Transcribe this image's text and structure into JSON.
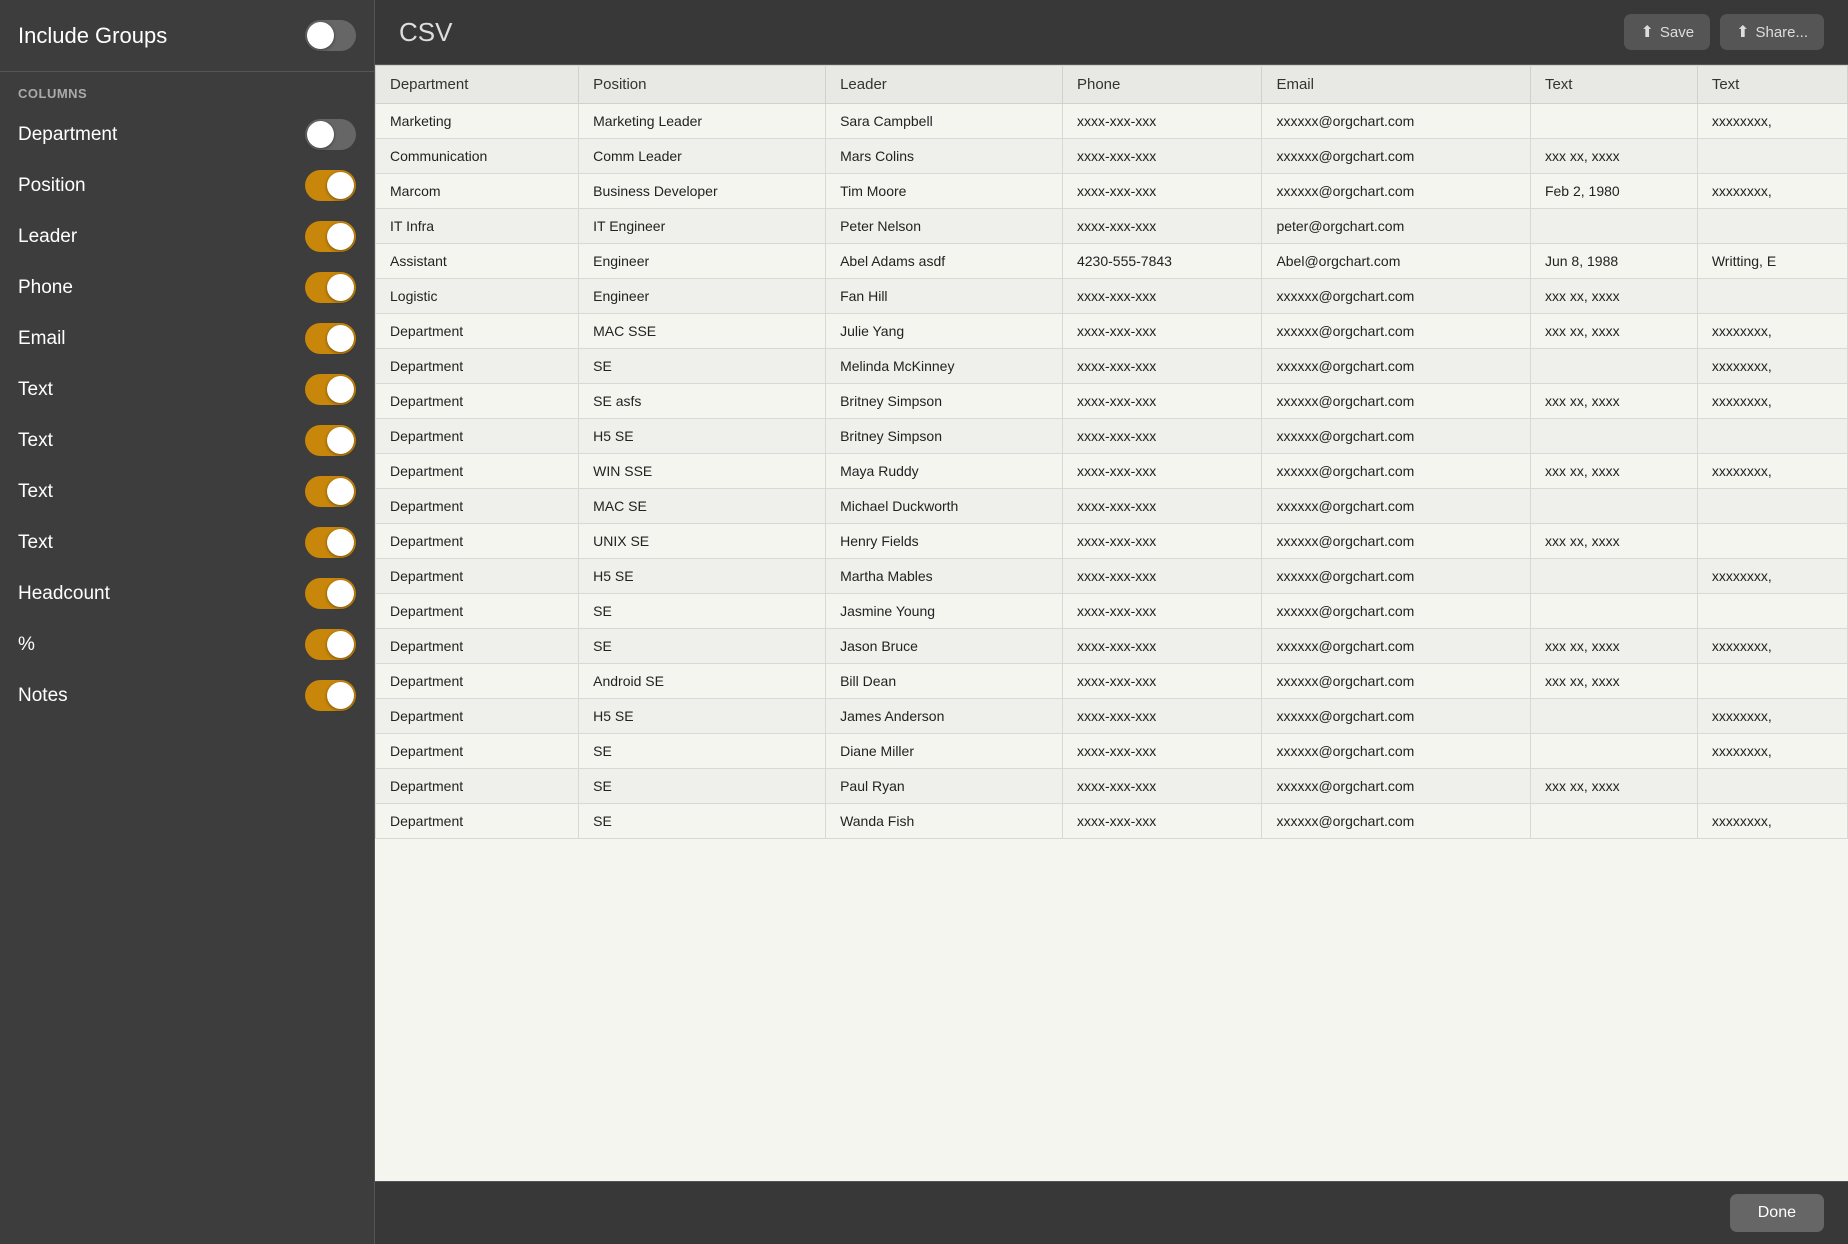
{
  "sidebar": {
    "include_groups_label": "Include Groups",
    "include_groups_on": false,
    "columns_label": "COLUMNS",
    "columns": [
      {
        "label": "Department",
        "on": false
      },
      {
        "label": "Position",
        "on": true
      },
      {
        "label": "Leader",
        "on": true
      },
      {
        "label": "Phone",
        "on": true
      },
      {
        "label": "Email",
        "on": true
      },
      {
        "label": "Text",
        "on": true
      },
      {
        "label": "Text",
        "on": true
      },
      {
        "label": "Text",
        "on": true
      },
      {
        "label": "Text",
        "on": true
      },
      {
        "label": "Headcount",
        "on": true
      },
      {
        "label": "%",
        "on": true
      },
      {
        "label": "Notes",
        "on": true
      }
    ]
  },
  "header": {
    "title": "CSV",
    "save_label": "Save",
    "share_label": "Share..."
  },
  "footer": {
    "done_label": "Done"
  },
  "table": {
    "columns": [
      "Department",
      "Position",
      "Leader",
      "Phone",
      "Email",
      "Text",
      "Text"
    ],
    "rows": [
      [
        "Marketing",
        "Marketing Leader",
        "Sara Campbell",
        "xxxx-xxx-xxx",
        "xxxxxx@orgchart.com",
        "",
        "xxxxxxxx,"
      ],
      [
        "Communication",
        "Comm Leader",
        "Mars Colins",
        "xxxx-xxx-xxx",
        "xxxxxx@orgchart.com",
        "xxx xx, xxxx",
        ""
      ],
      [
        "Marcom",
        "Business Developer",
        "Tim Moore",
        "xxxx-xxx-xxx",
        "xxxxxx@orgchart.com",
        "Feb 2, 1980",
        "xxxxxxxx,"
      ],
      [
        "IT Infra",
        "IT Engineer",
        "Peter Nelson",
        "xxxx-xxx-xxx",
        "peter@orgchart.com",
        "",
        ""
      ],
      [
        "Assistant",
        "Engineer",
        "Abel Adams asdf",
        "4230-555-7843",
        "Abel@orgchart.com",
        "Jun 8, 1988",
        "Writting, E"
      ],
      [
        "Logistic",
        "Engineer",
        "Fan Hill",
        "xxxx-xxx-xxx",
        "xxxxxx@orgchart.com",
        "xxx xx, xxxx",
        ""
      ],
      [
        "Department",
        "MAC SSE",
        "Julie Yang",
        "xxxx-xxx-xxx",
        "xxxxxx@orgchart.com",
        "xxx xx, xxxx",
        "xxxxxxxx,"
      ],
      [
        "Department",
        "SE",
        "Melinda McKinney",
        "xxxx-xxx-xxx",
        "xxxxxx@orgchart.com",
        "",
        "xxxxxxxx,"
      ],
      [
        "Department",
        "SE asfs",
        "Britney Simpson",
        "xxxx-xxx-xxx",
        "xxxxxx@orgchart.com",
        "xxx xx, xxxx",
        "xxxxxxxx,"
      ],
      [
        "Department",
        "H5 SE",
        "Britney Simpson",
        "xxxx-xxx-xxx",
        "xxxxxx@orgchart.com",
        "",
        ""
      ],
      [
        "Department",
        "WIN SSE",
        "Maya Ruddy",
        "xxxx-xxx-xxx",
        "xxxxxx@orgchart.com",
        "xxx xx, xxxx",
        "xxxxxxxx,"
      ],
      [
        "Department",
        "MAC SE",
        "Michael Duckworth",
        "xxxx-xxx-xxx",
        "xxxxxx@orgchart.com",
        "",
        ""
      ],
      [
        "Department",
        "UNIX SE",
        "Henry Fields",
        "xxxx-xxx-xxx",
        "xxxxxx@orgchart.com",
        "xxx xx, xxxx",
        ""
      ],
      [
        "Department",
        "H5 SE",
        "Martha Mables",
        "xxxx-xxx-xxx",
        "xxxxxx@orgchart.com",
        "",
        "xxxxxxxx,"
      ],
      [
        "Department",
        "SE",
        "Jasmine Young",
        "xxxx-xxx-xxx",
        "xxxxxx@orgchart.com",
        "",
        ""
      ],
      [
        "Department",
        "SE",
        "Jason Bruce",
        "xxxx-xxx-xxx",
        "xxxxxx@orgchart.com",
        "xxx xx, xxxx",
        "xxxxxxxx,"
      ],
      [
        "Department",
        "Android SE",
        "Bill Dean",
        "xxxx-xxx-xxx",
        "xxxxxx@orgchart.com",
        "xxx xx, xxxx",
        ""
      ],
      [
        "Department",
        "H5 SE",
        "James Anderson",
        "xxxx-xxx-xxx",
        "xxxxxx@orgchart.com",
        "",
        "xxxxxxxx,"
      ],
      [
        "Department",
        "SE",
        "Diane Miller",
        "xxxx-xxx-xxx",
        "xxxxxx@orgchart.com",
        "",
        "xxxxxxxx,"
      ],
      [
        "Department",
        "SE",
        "Paul Ryan",
        "xxxx-xxx-xxx",
        "xxxxxx@orgchart.com",
        "xxx xx, xxxx",
        ""
      ],
      [
        "Department",
        "SE",
        "Wanda Fish",
        "xxxx-xxx-xxx",
        "xxxxxx@orgchart.com",
        "",
        "xxxxxxxx,"
      ]
    ]
  }
}
